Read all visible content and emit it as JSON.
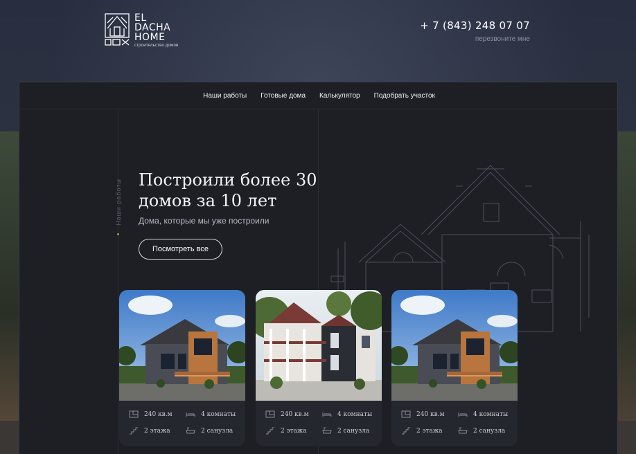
{
  "brand": {
    "line1": "EL",
    "line2": "DACHA",
    "line3": "HOME",
    "tagline": "строительство домов"
  },
  "contact": {
    "phone": "+ 7 (843) 248 07 07",
    "callback": "перезвоните мне"
  },
  "nav": {
    "items": [
      {
        "label": "Наши работы"
      },
      {
        "label": "Готовые дома"
      },
      {
        "label": "Калькулятор"
      },
      {
        "label": "Подобрать участок"
      }
    ]
  },
  "side_label": "Наши работы",
  "hero": {
    "title": "Построили более 30 домов за 10 лет",
    "subtitle": "Дома, которые мы уже построили",
    "button": "Посмотреть все"
  },
  "cards": [
    {
      "area": "240 кв.м",
      "rooms": "4 комнаты",
      "floors": "2 этажа",
      "baths": "2 санузла"
    },
    {
      "area": "240 кв.м",
      "rooms": "4 комнаты",
      "floors": "2 этажа",
      "baths": "2 санузла"
    },
    {
      "area": "240 кв.м",
      "rooms": "4 комнаты",
      "floors": "2 этажа",
      "baths": "2 санузла"
    }
  ],
  "colors": {
    "panel_bg": "#1d1f25",
    "card_bg": "#25272e",
    "accent_dot": "#c48a3a"
  }
}
